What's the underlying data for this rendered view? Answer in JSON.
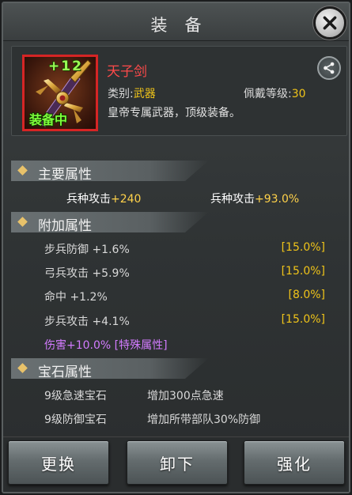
{
  "window": {
    "title": "装备"
  },
  "item": {
    "enhance_level": "+12",
    "equipped_badge": "装备中",
    "name": "天子剑",
    "type_label": "类别:",
    "type_value": "武器",
    "level_label": "佩戴等级:",
    "level_value": "30",
    "description": "皇帝专属武器，顶级装备。",
    "icon": "sword-icon"
  },
  "main_attributes": {
    "title": "主要属性",
    "stats": [
      {
        "name": "兵种攻击",
        "value": "+240"
      },
      {
        "name": "兵种攻击",
        "value": "+93.0%"
      }
    ]
  },
  "extra_attributes": {
    "title": "附加属性",
    "stats": [
      {
        "text": "步兵防御 +1.6%",
        "max": "[15.0%]"
      },
      {
        "text": "弓兵攻击 +5.9%",
        "max": "[15.0%]"
      },
      {
        "text": "命中 +1.2%",
        "max": "[8.0%]"
      },
      {
        "text": "步兵攻击 +4.1%",
        "max": "[15.0%]"
      }
    ],
    "special": "伤害+10.0% [特殊属性]"
  },
  "gem_attributes": {
    "title": "宝石属性",
    "gems": [
      {
        "name": "9级急速宝石",
        "effect": "增加300点急速"
      },
      {
        "name": "9级防御宝石",
        "effect": "增加所带部队30%防御"
      }
    ]
  },
  "buttons": {
    "replace": "更换",
    "unequip": "卸下",
    "enhance": "强化"
  },
  "colors": {
    "item_name": "#ff4a4a",
    "highlight_value": "#f0c419",
    "equipped": "#7dff3a",
    "special": "#d27bff"
  }
}
